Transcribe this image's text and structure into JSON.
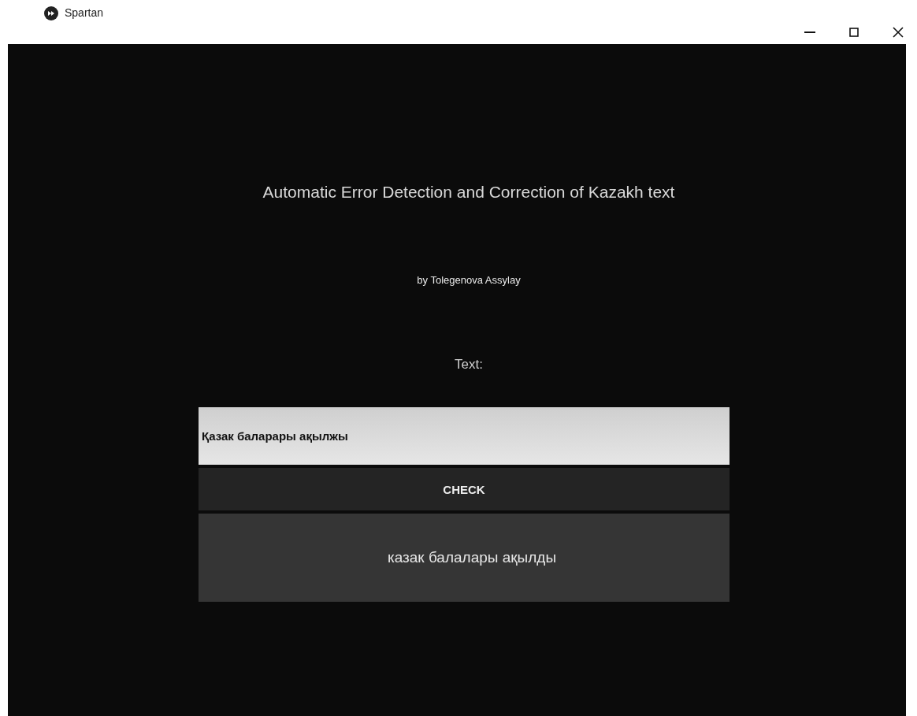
{
  "window": {
    "title": "Spartan"
  },
  "heading": "Automatic Error Detection and Correction of Kazakh text",
  "author": "by Tolegenova Assylay",
  "input_label": "Text:",
  "input": {
    "value": "Қазак баларары ақылжы"
  },
  "check_button": "CHECK",
  "result": "казак балалары ақылды"
}
